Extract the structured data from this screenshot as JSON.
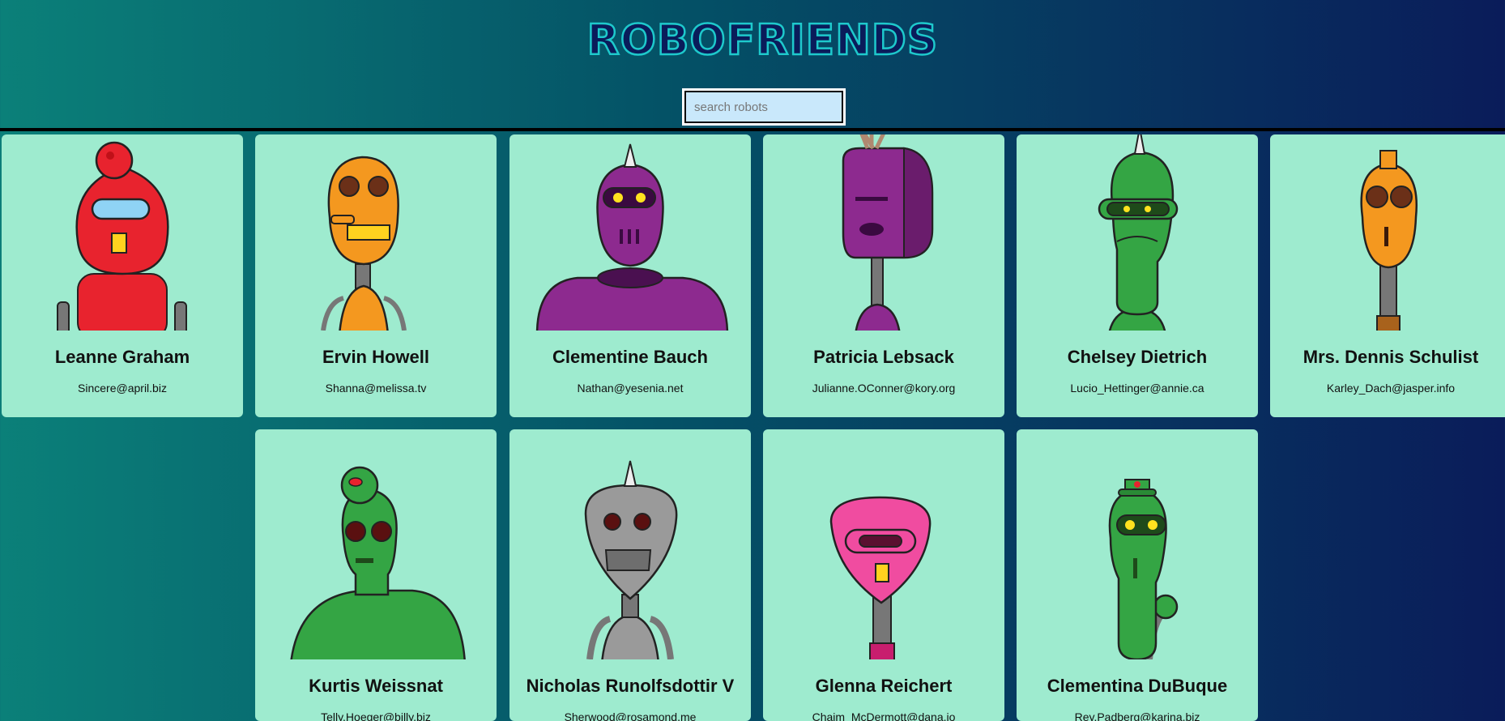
{
  "header": {
    "title": "robofriends",
    "search_placeholder": "search robots"
  },
  "robots": [
    {
      "name": "Leanne Graham",
      "email": "Sincere@april.biz",
      "color": "#e8232e",
      "icon": "red-robot-icon"
    },
    {
      "name": "Ervin Howell",
      "email": "Shanna@melissa.tv",
      "color": "#f4981f",
      "icon": "orange-robot-icon"
    },
    {
      "name": "Clementine Bauch",
      "email": "Nathan@yesenia.net",
      "color": "#8d2a8f",
      "icon": "purple-robot-icon"
    },
    {
      "name": "Patricia Lebsack",
      "email": "Julianne.OConner@kory.org",
      "color": "#8d2a8f",
      "icon": "purple-boxhead-robot-icon"
    },
    {
      "name": "Chelsey Dietrich",
      "email": "Lucio_Hettinger@annie.ca",
      "color": "#34a544",
      "icon": "green-robot-icon"
    },
    {
      "name": "Mrs. Dennis Schulist",
      "email": "Karley_Dach@jasper.info",
      "color": "#f4981f",
      "icon": "orange-robot-icon"
    },
    {
      "name": "Kurtis Weissnat",
      "email": "Telly.Hoeger@billy.biz",
      "color": "#34a544",
      "icon": "green-robot-icon"
    },
    {
      "name": "Nicholas Runolfsdottir V",
      "email": "Sherwood@rosamond.me",
      "color": "#9a9a9a",
      "icon": "gray-robot-icon"
    },
    {
      "name": "Glenna Reichert",
      "email": "Chaim_McDermott@dana.io",
      "color": "#f04ca0",
      "icon": "pink-robot-icon"
    },
    {
      "name": "Clementina DuBuque",
      "email": "Rey.Padberg@karina.biz",
      "color": "#34a544",
      "icon": "green-robot-icon"
    }
  ]
}
